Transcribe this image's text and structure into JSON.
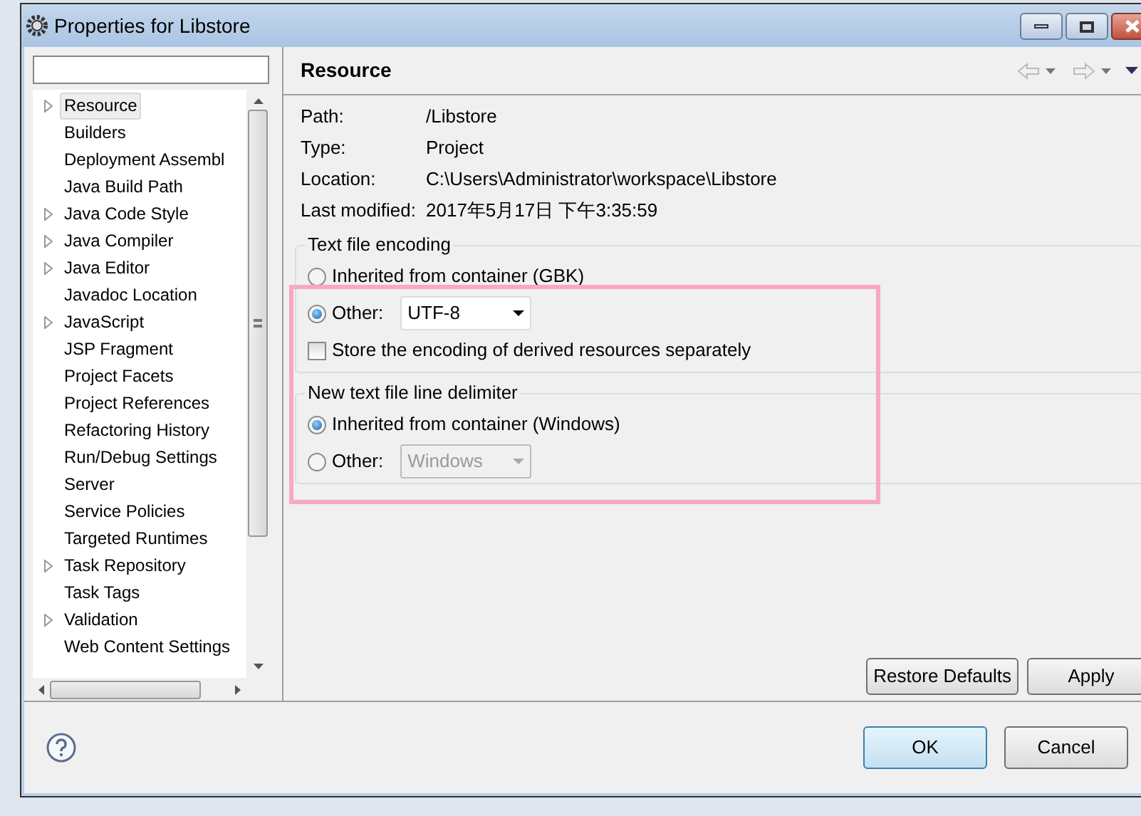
{
  "window": {
    "title": "Properties for Libstore"
  },
  "tree": [
    {
      "label": "Resource",
      "expandable": true,
      "selected": true
    },
    {
      "label": "Builders",
      "expandable": false,
      "selected": false
    },
    {
      "label": "Deployment Assembl",
      "expandable": false,
      "selected": false
    },
    {
      "label": "Java Build Path",
      "expandable": false,
      "selected": false
    },
    {
      "label": "Java Code Style",
      "expandable": true,
      "selected": false
    },
    {
      "label": "Java Compiler",
      "expandable": true,
      "selected": false
    },
    {
      "label": "Java Editor",
      "expandable": true,
      "selected": false
    },
    {
      "label": "Javadoc Location",
      "expandable": false,
      "selected": false
    },
    {
      "label": "JavaScript",
      "expandable": true,
      "selected": false
    },
    {
      "label": "JSP Fragment",
      "expandable": false,
      "selected": false
    },
    {
      "label": "Project Facets",
      "expandable": false,
      "selected": false
    },
    {
      "label": "Project References",
      "expandable": false,
      "selected": false
    },
    {
      "label": "Refactoring History",
      "expandable": false,
      "selected": false
    },
    {
      "label": "Run/Debug Settings",
      "expandable": false,
      "selected": false
    },
    {
      "label": "Server",
      "expandable": false,
      "selected": false
    },
    {
      "label": "Service Policies",
      "expandable": false,
      "selected": false
    },
    {
      "label": "Targeted Runtimes",
      "expandable": false,
      "selected": false
    },
    {
      "label": "Task Repository",
      "expandable": true,
      "selected": false
    },
    {
      "label": "Task Tags",
      "expandable": false,
      "selected": false
    },
    {
      "label": "Validation",
      "expandable": true,
      "selected": false
    },
    {
      "label": "Web Content Settings",
      "expandable": false,
      "selected": false
    }
  ],
  "page": {
    "title": "Resource",
    "properties": [
      {
        "label": "Path:",
        "value": "/Libstore"
      },
      {
        "label": "Type:",
        "value": "Project"
      },
      {
        "label": "Location:",
        "value": "C:\\Users\\Administrator\\workspace\\Libstore"
      },
      {
        "label": "Last modified:",
        "value": "2017年5月17日 下午3:35:59"
      }
    ],
    "groups": [
      {
        "title": "Text file encoding",
        "options": [
          {
            "kind": "radio",
            "label": "Inherited from container (GBK)",
            "checked": false
          },
          {
            "kind": "radio-combo",
            "label": "Other:",
            "checked": true,
            "value": "UTF-8",
            "disabled": false
          },
          {
            "kind": "checkbox",
            "label": "Store the encoding of derived resources separately",
            "checked": false
          }
        ]
      },
      {
        "title": "New text file line delimiter",
        "options": [
          {
            "kind": "radio",
            "label": "Inherited from container (Windows)",
            "checked": true
          },
          {
            "kind": "radio-combo",
            "label": "Other:",
            "checked": false,
            "value": "Windows",
            "disabled": true
          }
        ]
      }
    ],
    "buttons": [
      "Restore Defaults",
      "Apply"
    ]
  },
  "footer_buttons": [
    {
      "label": "OK",
      "default": true
    },
    {
      "label": "Cancel",
      "default": false
    }
  ]
}
